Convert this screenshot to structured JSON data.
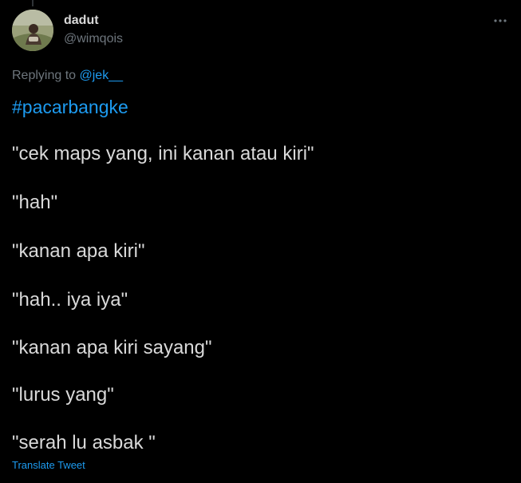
{
  "tweet": {
    "author": {
      "name": "dadut",
      "handle": "@wimqois"
    },
    "reply": {
      "prefix": "Replying to ",
      "mention": "@jek__"
    },
    "hashtag": "#pacarbangke",
    "lines": [
      "\"cek maps yang, ini kanan atau kiri\"",
      "\"hah\"",
      "\"kanan apa kiri\"",
      "\"hah.. iya iya\"",
      "\"kanan apa kiri sayang\"",
      "\"lurus yang\"",
      "\"serah lu asbak \""
    ],
    "translate_label": "Translate Tweet",
    "more_icon": "more-horizontal-icon"
  },
  "colors": {
    "background": "#000000",
    "text": "#d9d9d9",
    "muted": "#6e767d",
    "link": "#1d9bf0"
  }
}
